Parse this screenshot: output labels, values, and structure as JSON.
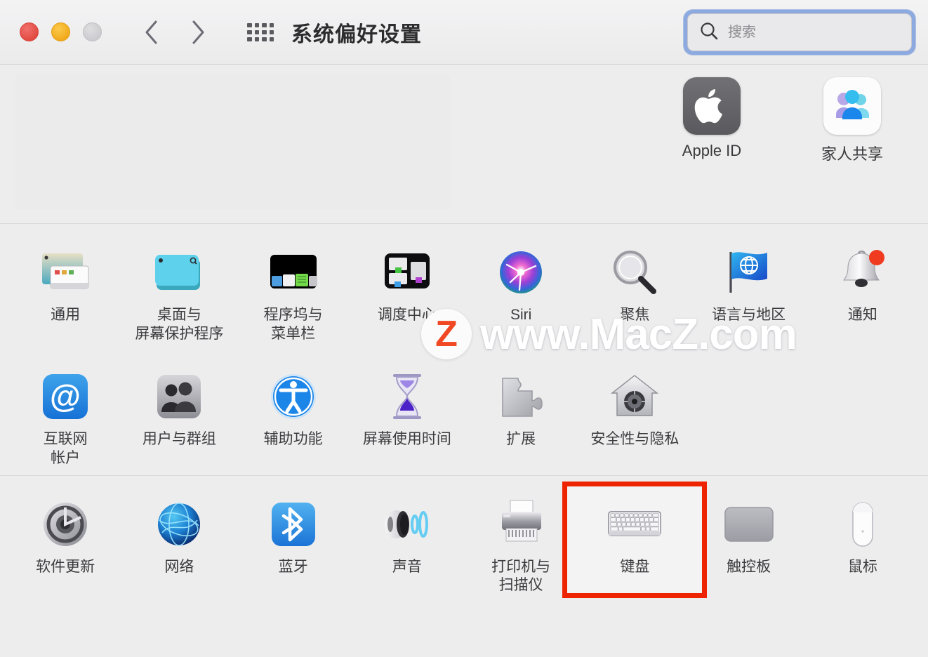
{
  "window": {
    "title": "系统偏好设置",
    "traffic_lights": [
      {
        "name": "close",
        "color": "#e0483f"
      },
      {
        "name": "minimize",
        "color": "#f0a81a"
      },
      {
        "name": "zoom",
        "color": "#cbcbcf"
      }
    ],
    "nav_back_icon": "chevron-left-icon",
    "nav_forward_icon": "chevron-right-icon",
    "grid_icon": "show-all-grid-icon"
  },
  "search": {
    "placeholder": "搜索",
    "value": "",
    "icon": "search-icon",
    "focus_ring_color": "#8daae0"
  },
  "account_section": {
    "items": [
      {
        "label": "Apple ID",
        "icon": "apple-logo-icon"
      },
      {
        "label": "家人共享",
        "icon": "family-sharing-icon"
      }
    ]
  },
  "rows": [
    {
      "name": "row-1",
      "items": [
        {
          "label": "通用",
          "icon": "general-window-icon"
        },
        {
          "label": "桌面与\n屏幕保护程序",
          "icon": "desktop-screensaver-icon"
        },
        {
          "label": "程序坞与\n菜单栏",
          "icon": "dock-menubar-icon"
        },
        {
          "label": "调度中心",
          "icon": "mission-control-icon"
        },
        {
          "label": "Siri",
          "icon": "siri-orb-icon"
        },
        {
          "label": "聚焦",
          "icon": "spotlight-magnifier-icon"
        },
        {
          "label": "语言与地区",
          "icon": "language-region-flag-icon"
        },
        {
          "label": "通知",
          "icon": "notifications-bell-icon"
        }
      ]
    },
    {
      "name": "row-2",
      "items": [
        {
          "label": "互联网\n帐户",
          "icon": "internet-accounts-at-icon"
        },
        {
          "label": "用户与群组",
          "icon": "users-groups-icon"
        },
        {
          "label": "辅助功能",
          "icon": "accessibility-icon"
        },
        {
          "label": "屏幕使用时间",
          "icon": "screen-time-hourglass-icon"
        },
        {
          "label": "扩展",
          "icon": "extensions-puzzle-icon"
        },
        {
          "label": "安全性与隐私",
          "icon": "security-privacy-house-icon"
        }
      ]
    },
    {
      "name": "row-3",
      "items": [
        {
          "label": "软件更新",
          "icon": "software-update-icon"
        },
        {
          "label": "网络",
          "icon": "network-globe-icon"
        },
        {
          "label": "蓝牙",
          "icon": "bluetooth-icon"
        },
        {
          "label": "声音",
          "icon": "sound-speaker-icon"
        },
        {
          "label": "打印机与\n扫描仪",
          "icon": "printers-scanners-icon"
        },
        {
          "label": "键盘",
          "icon": "keyboard-icon",
          "highlighted": true
        },
        {
          "label": "触控板",
          "icon": "trackpad-icon"
        },
        {
          "label": "鼠标",
          "icon": "mouse-icon"
        }
      ]
    }
  ],
  "annotation": {
    "highlight_color": "#ee2400",
    "highlight_target": "键盘"
  },
  "watermark": {
    "logo_letter": "Z",
    "text": "www.MacZ.com"
  }
}
